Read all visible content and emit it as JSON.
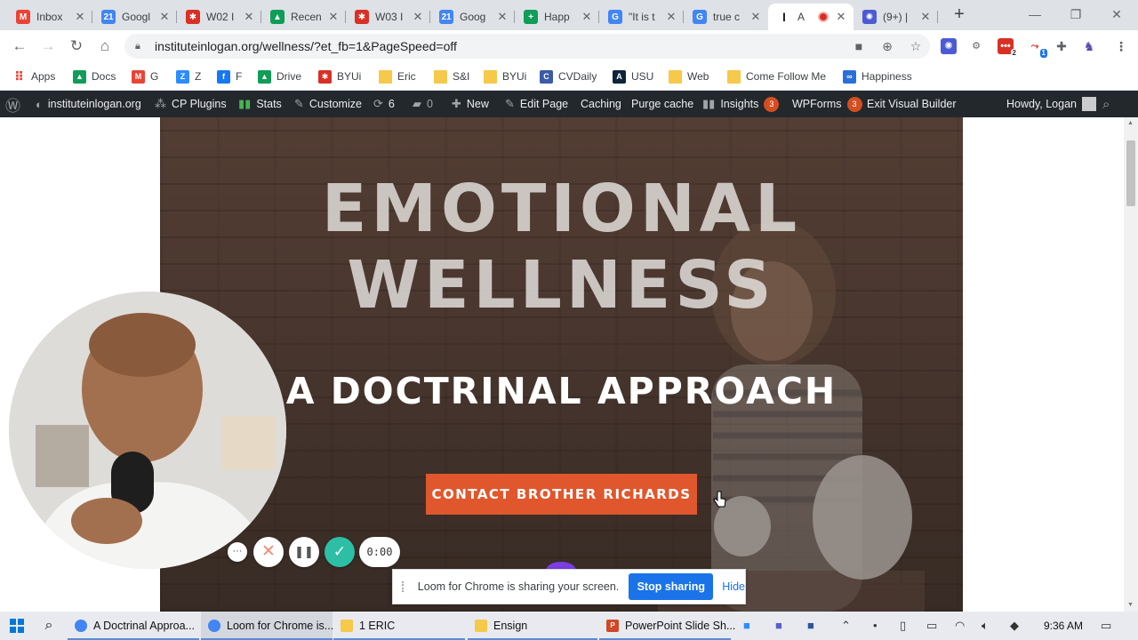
{
  "browser": {
    "tabs": [
      {
        "title": "Inbox",
        "icon": "gmail-icon",
        "color": "#ea4335",
        "glyph": "M"
      },
      {
        "title": "Googl",
        "icon": "google-calendar-icon",
        "color": "#4285f4",
        "glyph": "21"
      },
      {
        "title": "W02 I",
        "icon": "byui-icon",
        "color": "#d93025",
        "glyph": "✱"
      },
      {
        "title": "Recen",
        "icon": "google-drive-icon",
        "color": "#0f9d58",
        "glyph": "▲"
      },
      {
        "title": "W03 I",
        "icon": "byui-icon",
        "color": "#d93025",
        "glyph": "✱"
      },
      {
        "title": "Goog",
        "icon": "google-calendar-icon",
        "color": "#4285f4",
        "glyph": "21"
      },
      {
        "title": "Happ",
        "icon": "google-sheets-icon",
        "color": "#0f9d58",
        "glyph": "+"
      },
      {
        "title": "\"It is t",
        "icon": "google-icon",
        "color": "#4285f4",
        "glyph": "G"
      },
      {
        "title": "true c",
        "icon": "google-icon",
        "color": "#4285f4",
        "glyph": "G"
      },
      {
        "title": "A",
        "icon": "text-cursor-icon",
        "color": "#202124",
        "glyph": "I"
      },
      {
        "title": "(9+) |",
        "icon": "gear-icon",
        "color": "#4c5bd4",
        "glyph": "✺"
      }
    ],
    "new_tab": "+",
    "url": "instituteinlogan.org/wellness/?et_fb=1&PageSpeed=off",
    "bookmarks": [
      {
        "label": "Apps",
        "icon": "apps-grid-icon",
        "color": "#ea4335",
        "glyph": "⋮"
      },
      {
        "label": "Docs",
        "icon": "google-drive-icon",
        "color": "#0f9d58",
        "glyph": "▲"
      },
      {
        "label": "G",
        "icon": "gmail-icon",
        "color": "#ea4335",
        "glyph": "M"
      },
      {
        "label": "Z",
        "icon": "zoom-icon",
        "color": "#2d8cff",
        "glyph": "Z"
      },
      {
        "label": "F",
        "icon": "facebook-icon",
        "color": "#1877f2",
        "glyph": "f"
      },
      {
        "label": "Drive",
        "icon": "google-drive-icon",
        "color": "#0f9d58",
        "glyph": "▲"
      },
      {
        "label": "BYUi",
        "icon": "byui-icon",
        "color": "#d93025",
        "glyph": "✱"
      },
      {
        "label": "Eric",
        "icon": "folder-icon",
        "color": "#f6c94a",
        "glyph": ""
      },
      {
        "label": "S&I",
        "icon": "folder-icon",
        "color": "#f6c94a",
        "glyph": ""
      },
      {
        "label": "BYUi",
        "icon": "folder-icon",
        "color": "#f6c94a",
        "glyph": ""
      },
      {
        "label": "CVDaily",
        "icon": "cvdaily-icon",
        "color": "#3b5ba8",
        "glyph": "C"
      },
      {
        "label": "USU",
        "icon": "usu-icon",
        "color": "#0f2439",
        "glyph": "A"
      },
      {
        "label": "Web",
        "icon": "folder-icon",
        "color": "#f6c94a",
        "glyph": ""
      },
      {
        "label": "Come Follow Me",
        "icon": "folder-icon",
        "color": "#f6c94a",
        "glyph": ""
      },
      {
        "label": "Happiness",
        "icon": "infinity-icon",
        "color": "#2a6fdb",
        "glyph": "∞"
      }
    ]
  },
  "wp_admin": {
    "site": "instituteinlogan.org",
    "cp_plugins": "CP Plugins",
    "stats": "Stats",
    "customize": "Customize",
    "updates": "6",
    "comments": "0",
    "new": "New",
    "edit_page": "Edit Page",
    "caching": "Caching",
    "purge": "Purge cache",
    "insights": "Insights",
    "insights_count": "3",
    "wpforms": "WPForms",
    "wpforms_count": "3",
    "exit_vb": "Exit Visual Builder",
    "howdy": "Howdy, Logan"
  },
  "hero": {
    "title_line1": "EMOTIONAL",
    "title_line2": "WELLNESS",
    "subtitle": "A DOCTRINAL APPROACH",
    "cta": "CONTACT BROTHER RICHARDS",
    "cta_color": "#e0572d"
  },
  "loom": {
    "more": "···",
    "cancel": "✕",
    "pause": "❚❚",
    "done": "✓",
    "timer": "0:00",
    "share_text": "Loom for Chrome is sharing your screen.",
    "stop": "Stop sharing",
    "hide": "Hide"
  },
  "taskbar": {
    "items": [
      {
        "label": "A Doctrinal Approa...",
        "icon": "chrome-icon"
      },
      {
        "label": "Loom for Chrome is...",
        "icon": "chrome-icon"
      },
      {
        "label": "1 ERIC",
        "icon": "folder-icon"
      },
      {
        "label": "Ensign",
        "icon": "folder-icon"
      },
      {
        "label": "PowerPoint Slide Sh...",
        "icon": "powerpoint-icon"
      }
    ],
    "time": "9:36 AM"
  }
}
